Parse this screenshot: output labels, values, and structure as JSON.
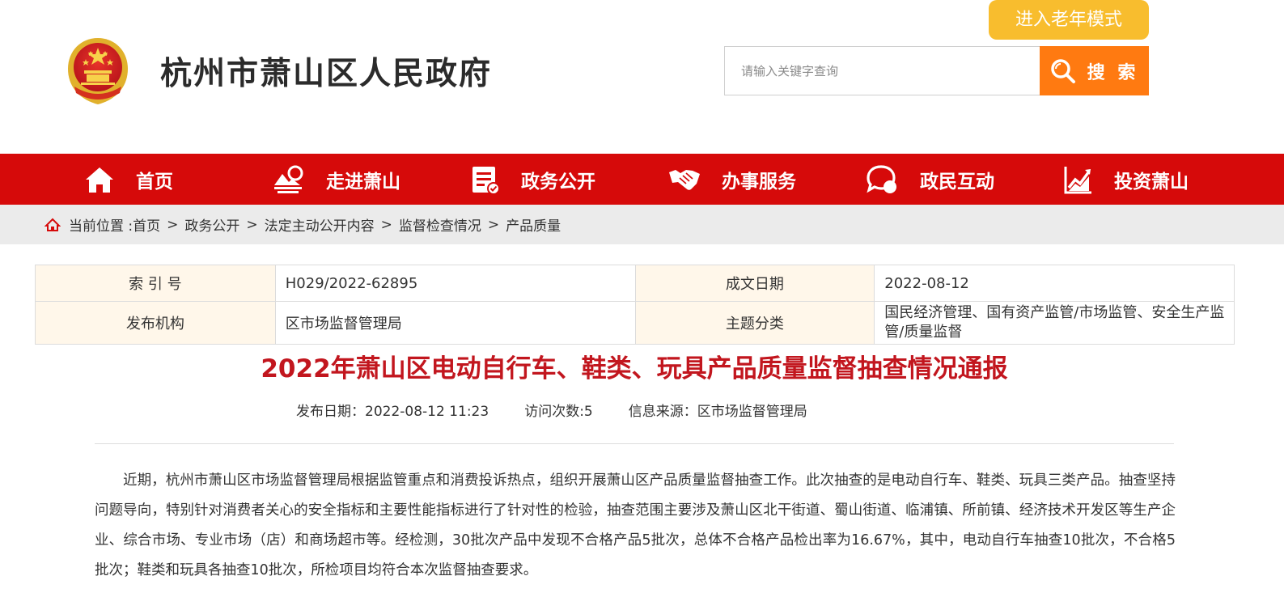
{
  "header": {
    "site_title": "杭州市萧山区人民政府",
    "elder_mode_label": "进入老年模式",
    "search_placeholder": "请输入关键字查询",
    "search_button_label": "搜 索"
  },
  "nav": {
    "items": [
      {
        "label": "首页",
        "icon": "home-icon"
      },
      {
        "label": "走进萧山",
        "icon": "landscape-icon"
      },
      {
        "label": "政务公开",
        "icon": "document-icon"
      },
      {
        "label": "办事服务",
        "icon": "handshake-icon"
      },
      {
        "label": "政民互动",
        "icon": "chat-icon"
      },
      {
        "label": "投资萧山",
        "icon": "trend-chart-icon"
      }
    ]
  },
  "breadcrumb": {
    "prefix": "当前位置 :",
    "items": [
      "首页",
      "政务公开",
      "法定主动公开内容",
      "监督检查情况",
      "产品质量"
    ],
    "separator": ">"
  },
  "info": {
    "index_no_label": "索 引 号",
    "index_no": "H029/2022-62895",
    "date_label": "成文日期",
    "date": "2022-08-12",
    "publisher_label": "发布机构",
    "publisher": "区市场监督管理局",
    "topic_label": "主题分类",
    "topic": "国民经济管理、国有资产监管/市场监管、安全生产监管/质量监督"
  },
  "article": {
    "title": "2022年萧山区电动自行车、鞋类、玩具产品质量监督抽查情况通报",
    "publish_date": "发布日期：2022-08-12 11:23",
    "visits": "访问次数:5",
    "source": "信息来源：区市场监督管理局",
    "paragraph": "近期，杭州市萧山区市场监督管理局根据监管重点和消费投诉热点，组织开展萧山区产品质量监督抽查工作。此次抽查的是电动自行车、鞋类、玩具三类产品。抽查坚持问题导向，特别针对消费者关心的安全指标和主要性能指标进行了针对性的检验，抽查范围主要涉及萧山区北干街道、蜀山街道、临浦镇、所前镇、经济技术开发区等生产企业、综合市场、专业市场（店）和商场超市等。经检测，30批次产品中发现不合格产品5批次，总体不合格产品检出率为16.67%，其中，电动自行车抽查10批次，不合格5批次；鞋类和玩具各抽查10批次，所检项目均符合本次监督抽查要求。"
  },
  "colors": {
    "nav_red": "#d60a0a",
    "search_orange": "#ff7a11",
    "elder_yellow": "#f8bd2e",
    "title_red": "#c2161e",
    "label_bg": "#fff7ea"
  }
}
